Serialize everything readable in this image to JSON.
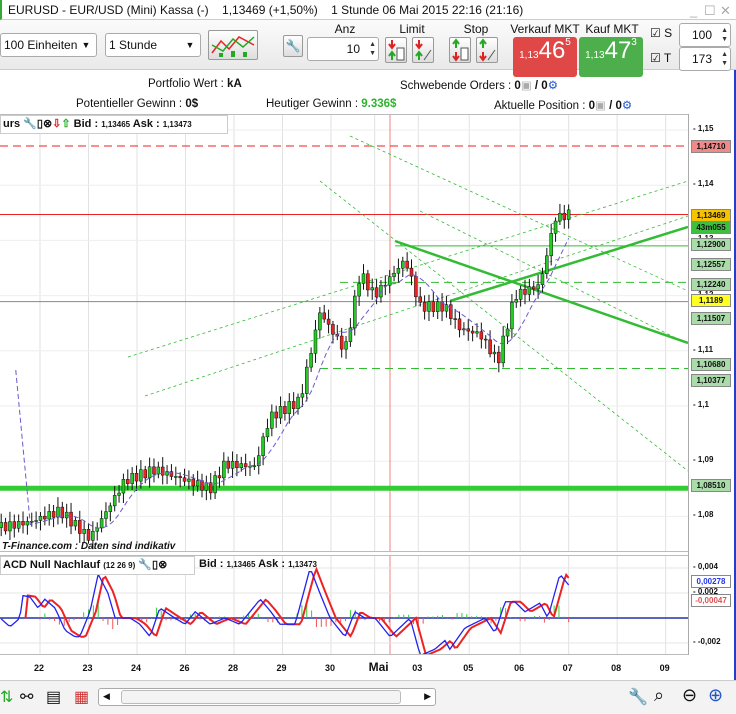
{
  "window": {
    "title": "EURUSD - EUR/USD (Mini) Kassa (-)",
    "price_change": "1,13469 (+1,50%)",
    "interval_time": "1 Stunde  06 Mai 2015 22:16 (21:16)"
  },
  "toolbar": {
    "units_value": "100 Einheiten",
    "interval_value": "1 Stunde",
    "anz_label": "Anz",
    "anz_value": "10",
    "limit_label": "Limit",
    "stop_label": "Stop",
    "sell": {
      "label": "Verkauf MKT",
      "small": "1,13",
      "big": "46",
      "sup": "5",
      "color": "#e04848"
    },
    "buy": {
      "label": "Kauf MKT",
      "small": "1,13",
      "big": "47",
      "sup": "3",
      "color": "#4caf4c"
    },
    "s_label": "S",
    "s_value": "100",
    "t_label": "T",
    "t_value": "173"
  },
  "info": {
    "portfolio_label": "Portfolio Wert : ",
    "portfolio_value": "kA",
    "pending_label": "Schwebende Orders : ",
    "pending_a": "0",
    "pending_b": " / 0",
    "potential_label": "Potentieller Gewinn : ",
    "potential_value": "0$",
    "today_label": "Heutiger Gewinn : ",
    "today_value": "9.336$",
    "position_label": "Aktuelle Position : ",
    "position_a": "0",
    "position_b": " / 0"
  },
  "main_legend": {
    "name": "urs",
    "bid_label": "Bid",
    "bid_value": "1,13465",
    "ask_label": "Ask",
    "ask_value": "1,13473"
  },
  "watermark": "T-Finance.com : Daten sind indikativ",
  "macd_legend": {
    "name": "ACD Null Nachlauf",
    "params": "(12 26 9)",
    "bid_label": "Bid",
    "bid_value": "1,13465",
    "ask_label": "Ask",
    "ask_value": "1,13473"
  },
  "price_axis": {
    "ticks": [
      "1,15",
      "1,14",
      "1,13",
      "1,12",
      "1,11",
      "1,1",
      "1,09",
      "1,08"
    ],
    "tags": [
      {
        "text": "1,14710",
        "bg": "#f08a8a"
      },
      {
        "text": "1,13469",
        "bg": "#f7c200"
      },
      {
        "text": "43m055",
        "bg": "#3fbf3f"
      },
      {
        "text": "1,12900",
        "bg": "#a9dca9"
      },
      {
        "text": "1,12557",
        "bg": "#a9dca9"
      },
      {
        "text": "1,12240",
        "bg": "#a9dca9"
      },
      {
        "text": "1,1189",
        "bg": "#ffff20"
      },
      {
        "text": "1,11507",
        "bg": "#a9dca9"
      },
      {
        "text": "1,10680",
        "bg": "#a9dca9"
      },
      {
        "text": "1,10377",
        "bg": "#a9dca9"
      },
      {
        "text": "1,08510",
        "bg": "#a9dca9"
      }
    ]
  },
  "macd_axis": {
    "ticks": [
      "0,004",
      "0,002",
      "-0,002"
    ],
    "tags": [
      {
        "text": "0,00278",
        "color": "#2233ee"
      },
      {
        "text": "-0,00047",
        "color": "#e05050"
      }
    ]
  },
  "date_axis": [
    "22",
    "23",
    "24",
    "26",
    "28",
    "29",
    "30",
    "Mai",
    "03",
    "05",
    "06",
    "07",
    "08",
    "09"
  ],
  "chart_data": {
    "type": "candlestick",
    "x_unit": "trading days from 22 Apr",
    "price_range": [
      1.075,
      1.153
    ],
    "price_path": [
      [
        -0.82,
        1.078
      ],
      [
        -0.21,
        1.079
      ],
      [
        0.41,
        1.081
      ],
      [
        1.03,
        1.076
      ],
      [
        1.75,
        1.0865
      ],
      [
        2.37,
        1.0885
      ],
      [
        3.51,
        1.085
      ],
      [
        3.81,
        1.0895
      ],
      [
        4.43,
        1.089
      ],
      [
        4.74,
        1.098
      ],
      [
        5.36,
        1.101
      ],
      [
        5.77,
        1.117
      ],
      [
        6.29,
        1.11
      ],
      [
        6.6,
        1.124
      ],
      [
        6.9,
        1.12
      ],
      [
        7.53,
        1.1265
      ],
      [
        7.84,
        1.118
      ],
      [
        8.35,
        1.118
      ],
      [
        8.66,
        1.114
      ],
      [
        9.07,
        1.113
      ],
      [
        9.44,
        1.108
      ],
      [
        9.79,
        1.12
      ],
      [
        10.31,
        1.122
      ],
      [
        10.62,
        1.134
      ],
      [
        10.87,
        1.1347
      ]
    ],
    "levels": [
      1.1471,
      1.13469,
      1.129,
      1.1224,
      1.1189,
      1.1068,
      1.0851
    ],
    "macd_range": [
      -0.0035,
      0.005
    ],
    "macd": [
      [
        -0.82,
        0.0
      ],
      [
        -0.62,
        -0.0007
      ],
      [
        -0.41,
        0.0
      ],
      [
        -0.37,
        0.0018
      ],
      [
        -0.21,
        0.0017
      ],
      [
        -0.04,
        0.0008
      ],
      [
        0.1,
        0.0015
      ],
      [
        0.31,
        0.0008
      ],
      [
        0.52,
        -0.001
      ],
      [
        0.72,
        -0.0015
      ],
      [
        0.82,
        -0.0015
      ],
      [
        1.03,
        0.0005
      ],
      [
        1.2,
        0.0035
      ],
      [
        1.4,
        0.002
      ],
      [
        1.55,
        0.0
      ],
      [
        1.86,
        0.0
      ],
      [
        2.06,
        -0.0005
      ],
      [
        2.27,
        -0.0015
      ],
      [
        2.47,
        0.0008
      ],
      [
        2.78,
        0.0
      ],
      [
        2.99,
        -0.0005
      ],
      [
        3.2,
        0.0005
      ],
      [
        3.51,
        -0.0005
      ],
      [
        3.81,
        0.0
      ],
      [
        4.12,
        -0.0005
      ],
      [
        4.54,
        0.0015
      ],
      [
        4.74,
        0.0006
      ],
      [
        4.95,
        -0.0005
      ],
      [
        5.26,
        -0.0005
      ],
      [
        5.57,
        0.004
      ],
      [
        5.77,
        0.002
      ],
      [
        5.98,
        0.0
      ],
      [
        6.29,
        -0.0015
      ],
      [
        6.49,
        0.0005
      ],
      [
        6.7,
        0.0
      ],
      [
        6.91,
        0.0
      ],
      [
        7.22,
        -0.0015
      ],
      [
        7.63,
        0.0
      ],
      [
        7.84,
        -0.003
      ],
      [
        8.14,
        -0.0025
      ],
      [
        8.35,
        -0.0018
      ],
      [
        8.45,
        -0.0025
      ],
      [
        8.76,
        -0.0008
      ],
      [
        9.18,
        0.0
      ],
      [
        9.38,
        -0.0012
      ],
      [
        9.59,
        0.0013
      ],
      [
        9.79,
        0.0013
      ],
      [
        10.0,
        0.0005
      ],
      [
        10.31,
        0.0012
      ],
      [
        10.47,
        0.0
      ],
      [
        10.72,
        0.0035
      ],
      [
        10.93,
        0.0025
      ]
    ]
  }
}
